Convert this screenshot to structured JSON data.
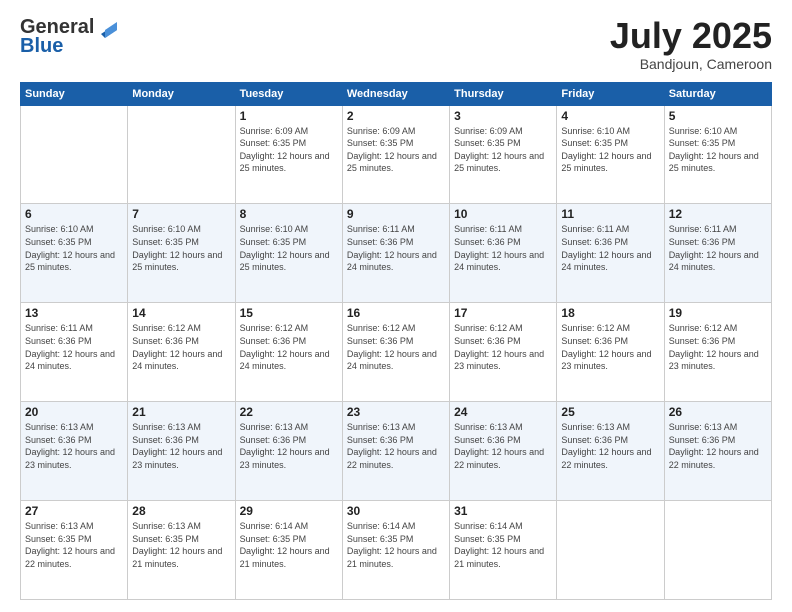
{
  "logo": {
    "general": "General",
    "blue": "Blue"
  },
  "title": {
    "month": "July 2025",
    "location": "Bandjoun, Cameroon"
  },
  "headers": [
    "Sunday",
    "Monday",
    "Tuesday",
    "Wednesday",
    "Thursday",
    "Friday",
    "Saturday"
  ],
  "weeks": [
    [
      {
        "day": "",
        "sunrise": "",
        "sunset": "",
        "daylight": ""
      },
      {
        "day": "",
        "sunrise": "",
        "sunset": "",
        "daylight": ""
      },
      {
        "day": "1",
        "sunrise": "Sunrise: 6:09 AM",
        "sunset": "Sunset: 6:35 PM",
        "daylight": "Daylight: 12 hours and 25 minutes."
      },
      {
        "day": "2",
        "sunrise": "Sunrise: 6:09 AM",
        "sunset": "Sunset: 6:35 PM",
        "daylight": "Daylight: 12 hours and 25 minutes."
      },
      {
        "day": "3",
        "sunrise": "Sunrise: 6:09 AM",
        "sunset": "Sunset: 6:35 PM",
        "daylight": "Daylight: 12 hours and 25 minutes."
      },
      {
        "day": "4",
        "sunrise": "Sunrise: 6:10 AM",
        "sunset": "Sunset: 6:35 PM",
        "daylight": "Daylight: 12 hours and 25 minutes."
      },
      {
        "day": "5",
        "sunrise": "Sunrise: 6:10 AM",
        "sunset": "Sunset: 6:35 PM",
        "daylight": "Daylight: 12 hours and 25 minutes."
      }
    ],
    [
      {
        "day": "6",
        "sunrise": "Sunrise: 6:10 AM",
        "sunset": "Sunset: 6:35 PM",
        "daylight": "Daylight: 12 hours and 25 minutes."
      },
      {
        "day": "7",
        "sunrise": "Sunrise: 6:10 AM",
        "sunset": "Sunset: 6:35 PM",
        "daylight": "Daylight: 12 hours and 25 minutes."
      },
      {
        "day": "8",
        "sunrise": "Sunrise: 6:10 AM",
        "sunset": "Sunset: 6:35 PM",
        "daylight": "Daylight: 12 hours and 25 minutes."
      },
      {
        "day": "9",
        "sunrise": "Sunrise: 6:11 AM",
        "sunset": "Sunset: 6:36 PM",
        "daylight": "Daylight: 12 hours and 24 minutes."
      },
      {
        "day": "10",
        "sunrise": "Sunrise: 6:11 AM",
        "sunset": "Sunset: 6:36 PM",
        "daylight": "Daylight: 12 hours and 24 minutes."
      },
      {
        "day": "11",
        "sunrise": "Sunrise: 6:11 AM",
        "sunset": "Sunset: 6:36 PM",
        "daylight": "Daylight: 12 hours and 24 minutes."
      },
      {
        "day": "12",
        "sunrise": "Sunrise: 6:11 AM",
        "sunset": "Sunset: 6:36 PM",
        "daylight": "Daylight: 12 hours and 24 minutes."
      }
    ],
    [
      {
        "day": "13",
        "sunrise": "Sunrise: 6:11 AM",
        "sunset": "Sunset: 6:36 PM",
        "daylight": "Daylight: 12 hours and 24 minutes."
      },
      {
        "day": "14",
        "sunrise": "Sunrise: 6:12 AM",
        "sunset": "Sunset: 6:36 PM",
        "daylight": "Daylight: 12 hours and 24 minutes."
      },
      {
        "day": "15",
        "sunrise": "Sunrise: 6:12 AM",
        "sunset": "Sunset: 6:36 PM",
        "daylight": "Daylight: 12 hours and 24 minutes."
      },
      {
        "day": "16",
        "sunrise": "Sunrise: 6:12 AM",
        "sunset": "Sunset: 6:36 PM",
        "daylight": "Daylight: 12 hours and 24 minutes."
      },
      {
        "day": "17",
        "sunrise": "Sunrise: 6:12 AM",
        "sunset": "Sunset: 6:36 PM",
        "daylight": "Daylight: 12 hours and 23 minutes."
      },
      {
        "day": "18",
        "sunrise": "Sunrise: 6:12 AM",
        "sunset": "Sunset: 6:36 PM",
        "daylight": "Daylight: 12 hours and 23 minutes."
      },
      {
        "day": "19",
        "sunrise": "Sunrise: 6:12 AM",
        "sunset": "Sunset: 6:36 PM",
        "daylight": "Daylight: 12 hours and 23 minutes."
      }
    ],
    [
      {
        "day": "20",
        "sunrise": "Sunrise: 6:13 AM",
        "sunset": "Sunset: 6:36 PM",
        "daylight": "Daylight: 12 hours and 23 minutes."
      },
      {
        "day": "21",
        "sunrise": "Sunrise: 6:13 AM",
        "sunset": "Sunset: 6:36 PM",
        "daylight": "Daylight: 12 hours and 23 minutes."
      },
      {
        "day": "22",
        "sunrise": "Sunrise: 6:13 AM",
        "sunset": "Sunset: 6:36 PM",
        "daylight": "Daylight: 12 hours and 23 minutes."
      },
      {
        "day": "23",
        "sunrise": "Sunrise: 6:13 AM",
        "sunset": "Sunset: 6:36 PM",
        "daylight": "Daylight: 12 hours and 22 minutes."
      },
      {
        "day": "24",
        "sunrise": "Sunrise: 6:13 AM",
        "sunset": "Sunset: 6:36 PM",
        "daylight": "Daylight: 12 hours and 22 minutes."
      },
      {
        "day": "25",
        "sunrise": "Sunrise: 6:13 AM",
        "sunset": "Sunset: 6:36 PM",
        "daylight": "Daylight: 12 hours and 22 minutes."
      },
      {
        "day": "26",
        "sunrise": "Sunrise: 6:13 AM",
        "sunset": "Sunset: 6:36 PM",
        "daylight": "Daylight: 12 hours and 22 minutes."
      }
    ],
    [
      {
        "day": "27",
        "sunrise": "Sunrise: 6:13 AM",
        "sunset": "Sunset: 6:35 PM",
        "daylight": "Daylight: 12 hours and 22 minutes."
      },
      {
        "day": "28",
        "sunrise": "Sunrise: 6:13 AM",
        "sunset": "Sunset: 6:35 PM",
        "daylight": "Daylight: 12 hours and 21 minutes."
      },
      {
        "day": "29",
        "sunrise": "Sunrise: 6:14 AM",
        "sunset": "Sunset: 6:35 PM",
        "daylight": "Daylight: 12 hours and 21 minutes."
      },
      {
        "day": "30",
        "sunrise": "Sunrise: 6:14 AM",
        "sunset": "Sunset: 6:35 PM",
        "daylight": "Daylight: 12 hours and 21 minutes."
      },
      {
        "day": "31",
        "sunrise": "Sunrise: 6:14 AM",
        "sunset": "Sunset: 6:35 PM",
        "daylight": "Daylight: 12 hours and 21 minutes."
      },
      {
        "day": "",
        "sunrise": "",
        "sunset": "",
        "daylight": ""
      },
      {
        "day": "",
        "sunrise": "",
        "sunset": "",
        "daylight": ""
      }
    ]
  ]
}
